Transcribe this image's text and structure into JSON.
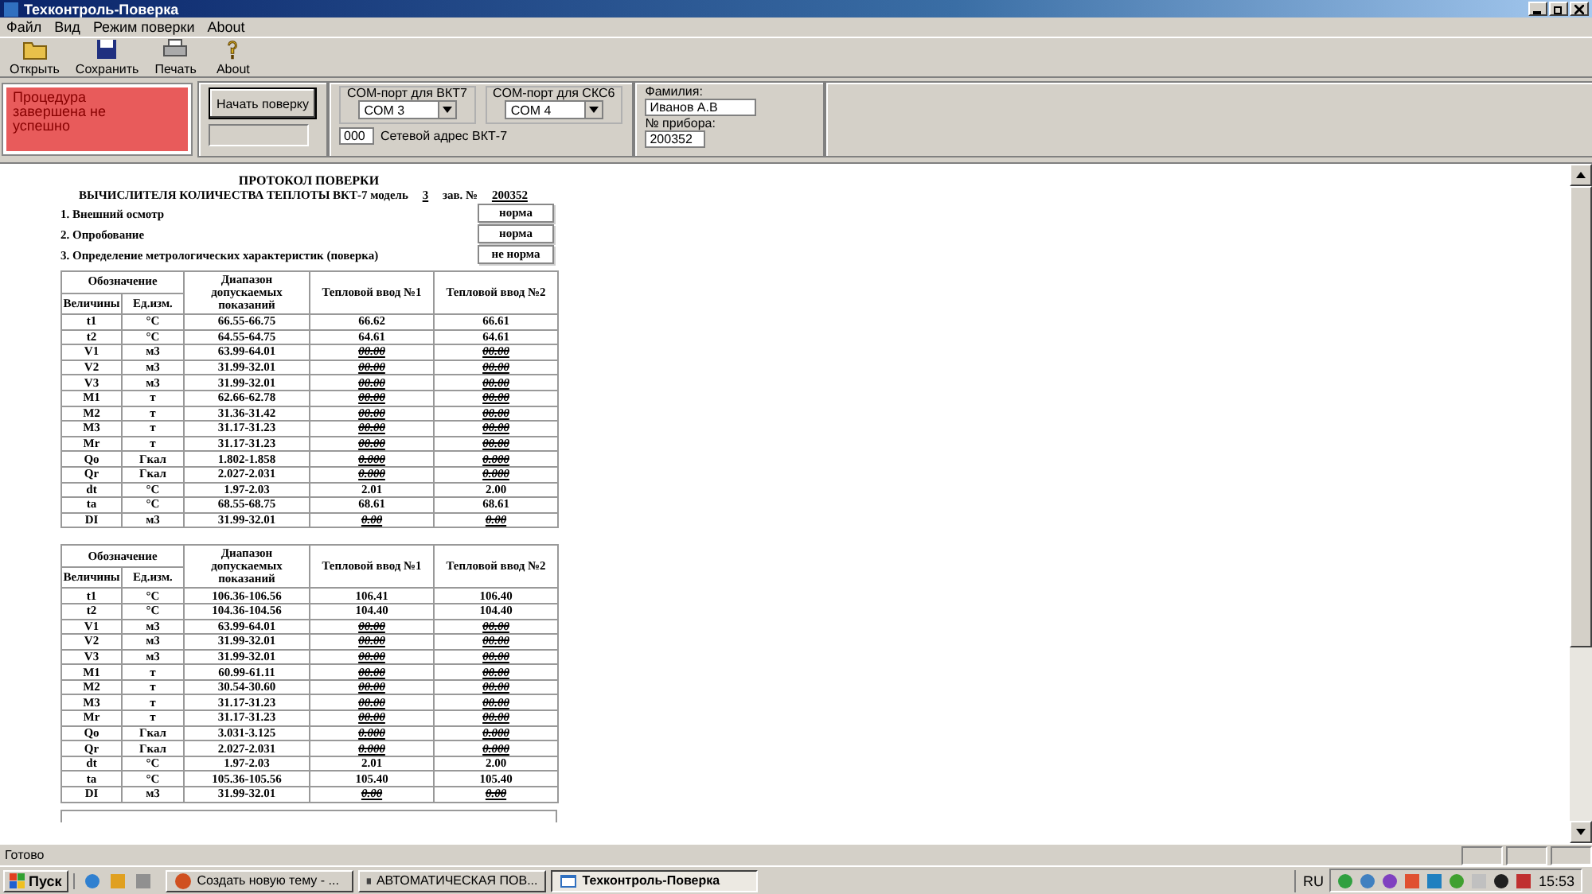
{
  "window": {
    "title": "Техконтроль-Поверка"
  },
  "menu": [
    "Файл",
    "Вид",
    "Режим поверки",
    "About"
  ],
  "toolbar": [
    {
      "kind": "open",
      "label": "Открыть"
    },
    {
      "kind": "save",
      "label": "Сохранить"
    },
    {
      "kind": "print",
      "label": "Печать"
    },
    {
      "kind": "about",
      "label": "About"
    }
  ],
  "status_panel": {
    "text": "Процедура завершена не успешно",
    "color": "#e85b5b"
  },
  "start_button": "Начать поверку",
  "com_vkt": {
    "label": "COM-порт для ВКТ7",
    "value": "COM 3"
  },
  "com_skc": {
    "label": "COM-порт для СКС6",
    "value": "COM 4"
  },
  "net_address": {
    "value": "000",
    "label": "Сетевой адрес ВКТ-7"
  },
  "surname": {
    "label": "Фамилия:",
    "value": "Иванов А.В"
  },
  "device_no": {
    "label": "№ прибора:",
    "value": "200352"
  },
  "protocol": {
    "title": "ПРОТОКОЛ ПОВЕРКИ",
    "subtitle": "ВЫЧИСЛИТЕЛЯ КОЛИЧЕСТВА ТЕПЛОТЫ ВКТ-7",
    "model_label": "модель",
    "model": "3",
    "serial_label": "зав. №",
    "serial": "200352",
    "checks": [
      {
        "label": "1. Внешний осмотр",
        "result": "норма"
      },
      {
        "label": "2. Опробование",
        "result": "норма"
      },
      {
        "label": "3. Определение метрологических характеристик (поверка)",
        "result": "не норма"
      }
    ],
    "tables": [
      {
        "header": {
          "group": "Обозначение",
          "quantity": "Величины",
          "unit": "Ед.изм.",
          "range": "Диапазон допускаемых показаний",
          "input1": "Тепловой ввод №1",
          "input2": "Тепловой ввод №2"
        },
        "rows": [
          {
            "name": "t1",
            "unit": "°C",
            "range": "66.55-66.75",
            "inputs": [
              {
                "value": "66.62",
                "ok": true
              },
              {
                "value": "66.61",
                "ok": true
              }
            ]
          },
          {
            "name": "t2",
            "unit": "°C",
            "range": "64.55-64.75",
            "inputs": [
              {
                "value": "64.61",
                "ok": true
              },
              {
                "value": "64.61",
                "ok": true
              }
            ]
          },
          {
            "name": "V1",
            "unit": "м3",
            "range": "63.99-64.01",
            "inputs": [
              {
                "value": "00.00",
                "ok": false
              },
              {
                "value": "00.00",
                "ok": false
              }
            ]
          },
          {
            "name": "V2",
            "unit": "м3",
            "range": "31.99-32.01",
            "inputs": [
              {
                "value": "00.00",
                "ok": false
              },
              {
                "value": "00.00",
                "ok": false
              }
            ]
          },
          {
            "name": "V3",
            "unit": "м3",
            "range": "31.99-32.01",
            "inputs": [
              {
                "value": "00.00",
                "ok": false
              },
              {
                "value": "00.00",
                "ok": false
              }
            ]
          },
          {
            "name": "M1",
            "unit": "т",
            "range": "62.66-62.78",
            "inputs": [
              {
                "value": "00.00",
                "ok": false
              },
              {
                "value": "00.00",
                "ok": false
              }
            ]
          },
          {
            "name": "M2",
            "unit": "т",
            "range": "31.36-31.42",
            "inputs": [
              {
                "value": "00.00",
                "ok": false
              },
              {
                "value": "00.00",
                "ok": false
              }
            ]
          },
          {
            "name": "M3",
            "unit": "т",
            "range": "31.17-31.23",
            "inputs": [
              {
                "value": "00.00",
                "ok": false
              },
              {
                "value": "00.00",
                "ok": false
              }
            ]
          },
          {
            "name": "Mr",
            "unit": "т",
            "range": "31.17-31.23",
            "inputs": [
              {
                "value": "00.00",
                "ok": false
              },
              {
                "value": "00.00",
                "ok": false
              }
            ]
          },
          {
            "name": "Qo",
            "unit": "Гкал",
            "range": "1.802-1.858",
            "inputs": [
              {
                "value": "0.000",
                "ok": false
              },
              {
                "value": "0.000",
                "ok": false
              }
            ]
          },
          {
            "name": "Qr",
            "unit": "Гкал",
            "range": "2.027-2.031",
            "inputs": [
              {
                "value": "0.000",
                "ok": false
              },
              {
                "value": "0.000",
                "ok": false
              }
            ]
          },
          {
            "name": "dt",
            "unit": "°C",
            "range": "1.97-2.03",
            "inputs": [
              {
                "value": "2.01",
                "ok": true
              },
              {
                "value": "2.00",
                "ok": true
              }
            ]
          },
          {
            "name": "ta",
            "unit": "°C",
            "range": "68.55-68.75",
            "inputs": [
              {
                "value": "68.61",
                "ok": true
              },
              {
                "value": "68.61",
                "ok": true
              }
            ]
          },
          {
            "name": "DI",
            "unit": "м3",
            "range": "31.99-32.01",
            "inputs": [
              {
                "value": "0.00",
                "ok": false
              },
              {
                "value": "0.00",
                "ok": false
              }
            ]
          }
        ]
      },
      {
        "header": {
          "group": "Обозначение",
          "quantity": "Величины",
          "unit": "Ед.изм.",
          "range": "Диапазон допускаемых показаний",
          "input1": "Тепловой ввод №1",
          "input2": "Тепловой ввод №2"
        },
        "rows": [
          {
            "name": "t1",
            "unit": "°C",
            "range": "106.36-106.56",
            "inputs": [
              {
                "value": "106.41",
                "ok": true
              },
              {
                "value": "106.40",
                "ok": true
              }
            ]
          },
          {
            "name": "t2",
            "unit": "°C",
            "range": "104.36-104.56",
            "inputs": [
              {
                "value": "104.40",
                "ok": true
              },
              {
                "value": "104.40",
                "ok": true
              }
            ]
          },
          {
            "name": "V1",
            "unit": "м3",
            "range": "63.99-64.01",
            "inputs": [
              {
                "value": "00.00",
                "ok": false
              },
              {
                "value": "00.00",
                "ok": false
              }
            ]
          },
          {
            "name": "V2",
            "unit": "м3",
            "range": "31.99-32.01",
            "inputs": [
              {
                "value": "00.00",
                "ok": false
              },
              {
                "value": "00.00",
                "ok": false
              }
            ]
          },
          {
            "name": "V3",
            "unit": "м3",
            "range": "31.99-32.01",
            "inputs": [
              {
                "value": "00.00",
                "ok": false
              },
              {
                "value": "00.00",
                "ok": false
              }
            ]
          },
          {
            "name": "M1",
            "unit": "т",
            "range": "60.99-61.11",
            "inputs": [
              {
                "value": "00.00",
                "ok": false
              },
              {
                "value": "00.00",
                "ok": false
              }
            ]
          },
          {
            "name": "M2",
            "unit": "т",
            "range": "30.54-30.60",
            "inputs": [
              {
                "value": "00.00",
                "ok": false
              },
              {
                "value": "00.00",
                "ok": false
              }
            ]
          },
          {
            "name": "M3",
            "unit": "т",
            "range": "31.17-31.23",
            "inputs": [
              {
                "value": "00.00",
                "ok": false
              },
              {
                "value": "00.00",
                "ok": false
              }
            ]
          },
          {
            "name": "Mr",
            "unit": "т",
            "range": "31.17-31.23",
            "inputs": [
              {
                "value": "00.00",
                "ok": false
              },
              {
                "value": "00.00",
                "ok": false
              }
            ]
          },
          {
            "name": "Qo",
            "unit": "Гкал",
            "range": "3.031-3.125",
            "inputs": [
              {
                "value": "0.000",
                "ok": false
              },
              {
                "value": "0.000",
                "ok": false
              }
            ]
          },
          {
            "name": "Qr",
            "unit": "Гкал",
            "range": "2.027-2.031",
            "inputs": [
              {
                "value": "0.000",
                "ok": false
              },
              {
                "value": "0.000",
                "ok": false
              }
            ]
          },
          {
            "name": "dt",
            "unit": "°C",
            "range": "1.97-2.03",
            "inputs": [
              {
                "value": "2.01",
                "ok": true
              },
              {
                "value": "2.00",
                "ok": true
              }
            ]
          },
          {
            "name": "ta",
            "unit": "°C",
            "range": "105.36-105.56",
            "inputs": [
              {
                "value": "105.40",
                "ok": true
              },
              {
                "value": "105.40",
                "ok": true
              }
            ]
          },
          {
            "name": "DI",
            "unit": "м3",
            "range": "31.99-32.01",
            "inputs": [
              {
                "value": "0.00",
                "ok": false
              },
              {
                "value": "0.00",
                "ok": false
              }
            ]
          }
        ]
      }
    ]
  },
  "status_bar": "Готово",
  "taskbar": {
    "start": "Пуск",
    "tasks": [
      {
        "label": "Создать новую тему - ...",
        "kind": "browser",
        "selected": false
      },
      {
        "label": "АВТОМАТИЧЕСКАЯ ПОВ...",
        "kind": "document",
        "selected": false
      },
      {
        "label": "Техконтроль-Поверка",
        "kind": "app",
        "selected": true
      }
    ],
    "language": "RU",
    "clock": "15:53"
  }
}
